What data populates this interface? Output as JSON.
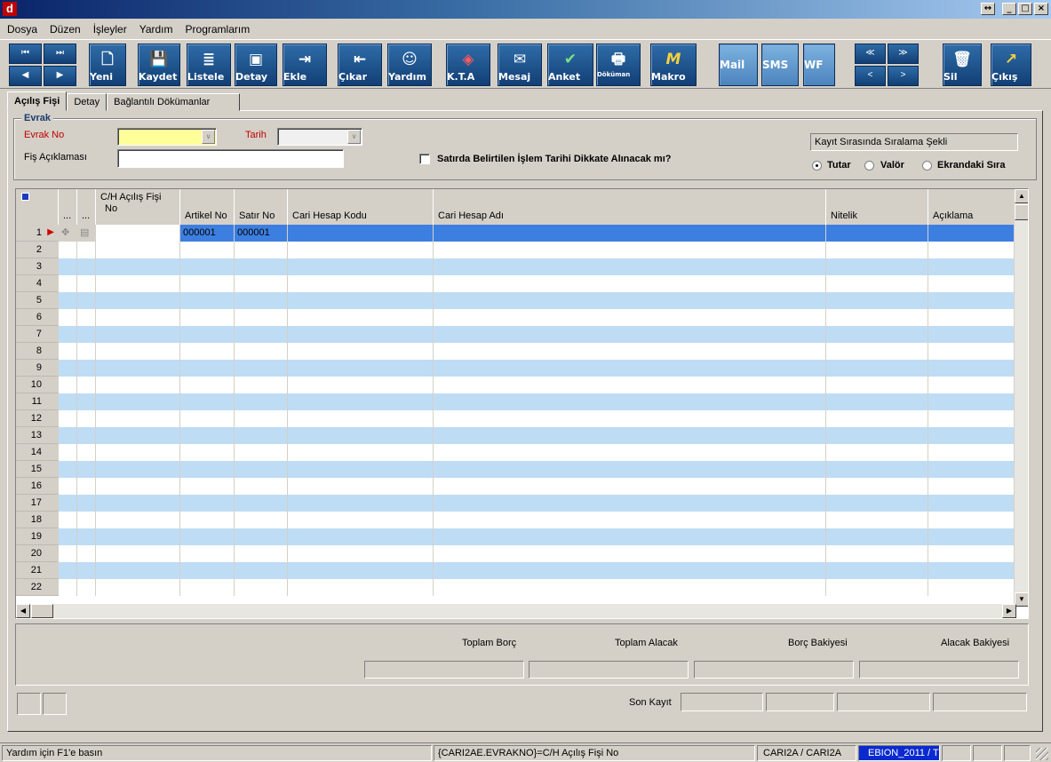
{
  "titlebar": {
    "app_icon_letter": "d"
  },
  "menu": [
    "Dosya",
    "Düzen",
    "İşleyler",
    "Yardım",
    "Programlarım"
  ],
  "toolbar": {
    "nav": {
      "first": "⏮",
      "last": "⏭",
      "prev": "◀",
      "next": "▶"
    },
    "buttons": [
      {
        "label": "Yeni",
        "icon": "new-document-icon",
        "glyph": "🗋"
      },
      {
        "label": "Kaydet",
        "icon": "save-icon",
        "glyph": "💾"
      },
      {
        "label": "Listele",
        "icon": "list-icon",
        "glyph": "≣"
      },
      {
        "label": "Detay",
        "icon": "detail-icon",
        "glyph": "▣"
      },
      {
        "label": "Ekle",
        "icon": "insert-icon",
        "glyph": "⇥"
      },
      {
        "label": "Çıkar",
        "icon": "remove-icon",
        "glyph": "⇤"
      },
      {
        "label": "Yardım",
        "icon": "help-smiley-icon",
        "glyph": "☺"
      },
      {
        "label": "K.T.A",
        "icon": "kta-diamond-icon",
        "glyph": "◈"
      },
      {
        "label": "Mesaj",
        "icon": "message-icon",
        "glyph": "✉"
      },
      {
        "label": "Anket",
        "icon": "survey-icon",
        "glyph": "✔"
      },
      {
        "label": "Döküman",
        "icon": "document-printer-icon",
        "glyph": "🖶"
      },
      {
        "label": "Makro",
        "icon": "macro-icon",
        "glyph": "M"
      },
      {
        "label": "Mail",
        "icon": "",
        "glyph": ""
      },
      {
        "label": "SMS",
        "icon": "",
        "glyph": ""
      },
      {
        "label": "WF",
        "icon": "",
        "glyph": ""
      },
      {
        "label": "Sil",
        "icon": "trash-icon",
        "glyph": "🗑"
      },
      {
        "label": "Çıkış",
        "icon": "exit-arrow-icon",
        "glyph": "↗"
      }
    ],
    "nav2": {
      "a": "≪",
      "b": "≫",
      "c": "<",
      "d": ">"
    }
  },
  "tabs": [
    "Açılış Fişi",
    "Detay",
    "Bağlantılı Dökümanlar"
  ],
  "evrak": {
    "legend": "Evrak",
    "evrak_no_label": "Evrak No",
    "evrak_no_value": "",
    "tarih_label": "Tarih",
    "tarih_value": "",
    "fis_aciklamasi_label": "Fiş Açıklaması",
    "fis_aciklamasi_value": "",
    "checkbox_label": "Satırda Belirtilen İşlem Tarihi Dikkate Alınacak mı?",
    "checkbox_checked": false,
    "sort_label": "Kayıt Sırasında Sıralama Şekli",
    "sort_options": [
      "Tutar",
      "Valör",
      "Ekrandaki Sıra"
    ],
    "sort_selected": "Tutar"
  },
  "grid": {
    "columns": [
      "",
      "...",
      "...",
      "C/H Açılış Fişi No",
      "Artikel No",
      "Satır No",
      "Cari Hesap Kodu",
      "Cari Hesap Adı",
      "Nitelik",
      "Açıklama"
    ],
    "col_hdr_line1": "C/H Açılış Fişi",
    "col_hdr_line2": "No",
    "rows": [
      {
        "n": "1",
        "artikel": "000001",
        "satir": "000001"
      },
      {
        "n": "2"
      },
      {
        "n": "3"
      },
      {
        "n": "4"
      },
      {
        "n": "5"
      },
      {
        "n": "6"
      },
      {
        "n": "7"
      },
      {
        "n": "8"
      },
      {
        "n": "9"
      },
      {
        "n": "10"
      },
      {
        "n": "11"
      },
      {
        "n": "12"
      },
      {
        "n": "13"
      },
      {
        "n": "14"
      },
      {
        "n": "15"
      },
      {
        "n": "16"
      },
      {
        "n": "17"
      },
      {
        "n": "18"
      },
      {
        "n": "19"
      },
      {
        "n": "20"
      },
      {
        "n": "21"
      },
      {
        "n": "22"
      }
    ]
  },
  "totals": {
    "toplam_borc": "Toplam Borç",
    "toplam_alacak": "Toplam Alacak",
    "borc_bakiyesi": "Borç Bakiyesi",
    "alacak_bakiyesi": "Alacak Bakiyesi",
    "son_kayit": "Son Kayıt"
  },
  "status": {
    "help": "Yardım için F1'e basın",
    "field": "{CARI2AE.EVRAKNO}=C/H Açılış Fişi No",
    "module": "CARI2A / CARI2A",
    "db": "EBION_2011 / T"
  },
  "colors": {
    "selected_row": "#3d7fe0",
    "alt_row": "#bfdcf5",
    "evrak_no_bg": "#ffff99",
    "required_label": "#c00000"
  }
}
